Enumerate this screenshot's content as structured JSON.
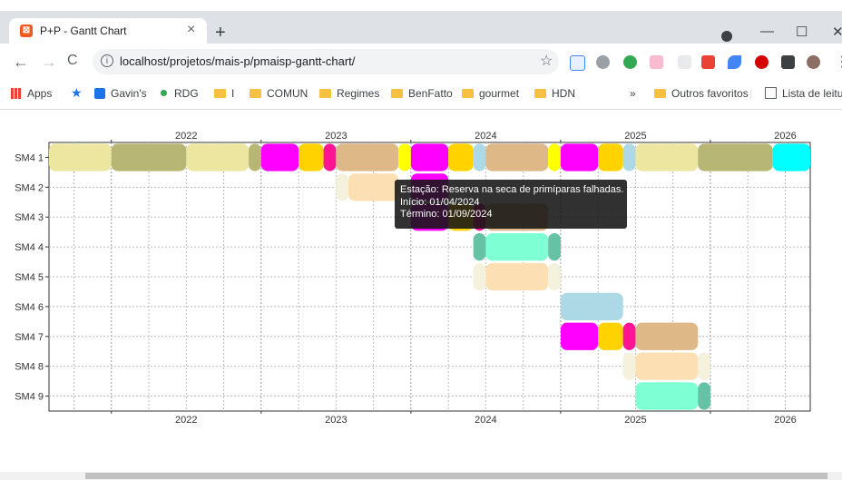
{
  "browser": {
    "tab_title": "P+P - Gantt Chart",
    "tab_favicon": "⊠",
    "close_glyph": "×",
    "newtab_glyph": "+",
    "url": "localhost/projetos/mais-p/pmaisp-gantt-chart/",
    "info_glyph": "i",
    "minimize_glyph": "—",
    "maximize_glyph": "☐",
    "window_close_glyph": "✕",
    "back_glyph": "←",
    "forward_glyph": "→",
    "reload_glyph": "C",
    "star_glyph": "☆",
    "menu_glyph": "⋮",
    "bookmarks": {
      "apps": "Apps",
      "gavins": "Gavin's",
      "rdg": "RDG",
      "i": "I",
      "comun": "COMUN",
      "regimes": "Regimes",
      "benfatto": "BenFatto",
      "gourmet": "gourmet",
      "hdn": "HDN",
      "more": "»",
      "outros": "Outros favoritos",
      "lista": "Lista de leitura"
    }
  },
  "chart_data": {
    "type": "gantt",
    "years": [
      "2022",
      "2023",
      "2024",
      "2025",
      "2026"
    ],
    "rows": [
      "SM4 1",
      "SM4 2",
      "SM4 3",
      "SM4 4",
      "SM4 5",
      "SM4 6",
      "SM4 7",
      "SM4 8",
      "SM4 9"
    ],
    "x_start": "2021-08",
    "x_end": "2026-09",
    "tasks": [
      {
        "row": 0,
        "start": "2021-08-01",
        "end": "2022-01-01",
        "color": "#ece6a0"
      },
      {
        "row": 0,
        "start": "2022-01-01",
        "end": "2022-07-01",
        "color": "#b8b674"
      },
      {
        "row": 0,
        "start": "2022-07-01",
        "end": "2022-12-01",
        "color": "#ece6a0"
      },
      {
        "row": 0,
        "start": "2022-12-01",
        "end": "2023-01-01",
        "color": "#b8b674"
      },
      {
        "row": 0,
        "start": "2023-01-01",
        "end": "2023-04-01",
        "color": "#ff00ff"
      },
      {
        "row": 0,
        "start": "2023-04-01",
        "end": "2023-06-01",
        "color": "#ffd200"
      },
      {
        "row": 0,
        "start": "2023-06-01",
        "end": "2023-07-01",
        "color": "#ff1493"
      },
      {
        "row": 0,
        "start": "2023-07-01",
        "end": "2023-12-01",
        "color": "#deb887"
      },
      {
        "row": 0,
        "start": "2023-12-01",
        "end": "2024-01-01",
        "color": "#ffff00"
      },
      {
        "row": 0,
        "start": "2024-01-01",
        "end": "2024-04-01",
        "color": "#ff00ff"
      },
      {
        "row": 0,
        "start": "2024-04-01",
        "end": "2024-06-01",
        "color": "#ffd200"
      },
      {
        "row": 0,
        "start": "2024-06-01",
        "end": "2024-07-01",
        "color": "#add8e6"
      },
      {
        "row": 0,
        "start": "2024-07-01",
        "end": "2024-12-01",
        "color": "#deb887"
      },
      {
        "row": 0,
        "start": "2024-12-01",
        "end": "2025-01-01",
        "color": "#ffff00"
      },
      {
        "row": 0,
        "start": "2025-01-01",
        "end": "2025-04-01",
        "color": "#ff00ff"
      },
      {
        "row": 0,
        "start": "2025-04-01",
        "end": "2025-06-01",
        "color": "#ffd200"
      },
      {
        "row": 0,
        "start": "2025-06-01",
        "end": "2025-07-01",
        "color": "#add8e6"
      },
      {
        "row": 0,
        "start": "2025-07-01",
        "end": "2025-12-01",
        "color": "#ece6a0"
      },
      {
        "row": 0,
        "start": "2025-12-01",
        "end": "2026-06-01",
        "color": "#b8b674"
      },
      {
        "row": 0,
        "start": "2026-06-01",
        "end": "2026-09-01",
        "color": "#00ffff"
      },
      {
        "row": 1,
        "start": "2023-07-01",
        "end": "2023-08-01",
        "color": "#f4f1dc"
      },
      {
        "row": 1,
        "start": "2023-08-01",
        "end": "2023-12-01",
        "color": "#fce0b4"
      },
      {
        "row": 1,
        "start": "2024-01-01",
        "end": "2024-04-01",
        "color": "#ff00ff"
      },
      {
        "row": 2,
        "start": "2024-01-01",
        "end": "2024-04-01",
        "color": "#ff00ff"
      },
      {
        "row": 2,
        "start": "2024-04-01",
        "end": "2024-06-01",
        "color": "#ffd200"
      },
      {
        "row": 2,
        "start": "2024-06-01",
        "end": "2024-07-01",
        "color": "#ff1493"
      },
      {
        "row": 2,
        "start": "2024-07-01",
        "end": "2024-12-01",
        "color": "#deb887"
      },
      {
        "row": 3,
        "start": "2024-06-01",
        "end": "2024-07-01",
        "color": "#66c2a5"
      },
      {
        "row": 3,
        "start": "2024-07-01",
        "end": "2024-12-01",
        "color": "#7fffd4"
      },
      {
        "row": 3,
        "start": "2024-12-01",
        "end": "2025-01-01",
        "color": "#66c2a5"
      },
      {
        "row": 4,
        "start": "2024-06-01",
        "end": "2024-07-01",
        "color": "#f4f1dc"
      },
      {
        "row": 4,
        "start": "2024-07-01",
        "end": "2024-12-01",
        "color": "#fce0b4"
      },
      {
        "row": 4,
        "start": "2024-12-01",
        "end": "2025-01-01",
        "color": "#f4f1dc"
      },
      {
        "row": 5,
        "start": "2025-01-01",
        "end": "2025-06-01",
        "color": "#add8e6"
      },
      {
        "row": 6,
        "start": "2025-01-01",
        "end": "2025-04-01",
        "color": "#ff00ff"
      },
      {
        "row": 6,
        "start": "2025-04-01",
        "end": "2025-06-01",
        "color": "#ffd200"
      },
      {
        "row": 6,
        "start": "2025-06-01",
        "end": "2025-07-01",
        "color": "#ff1493"
      },
      {
        "row": 6,
        "start": "2025-07-01",
        "end": "2025-12-01",
        "color": "#deb887"
      },
      {
        "row": 7,
        "start": "2025-06-01",
        "end": "2025-07-01",
        "color": "#f4f1dc"
      },
      {
        "row": 7,
        "start": "2025-07-01",
        "end": "2025-12-01",
        "color": "#fce0b4"
      },
      {
        "row": 7,
        "start": "2025-12-01",
        "end": "2026-01-01",
        "color": "#f4f1dc"
      },
      {
        "row": 8,
        "start": "2025-07-01",
        "end": "2025-12-01",
        "color": "#7fffd4"
      },
      {
        "row": 8,
        "start": "2025-12-01",
        "end": "2026-01-01",
        "color": "#66c2a5"
      }
    ],
    "tooltip": {
      "line1": "Estação: Reserva na seca de primíparas falhadas.",
      "line2": "Início: 01/04/2024",
      "line3": "Término: 01/09/2024"
    },
    "grid": true
  }
}
